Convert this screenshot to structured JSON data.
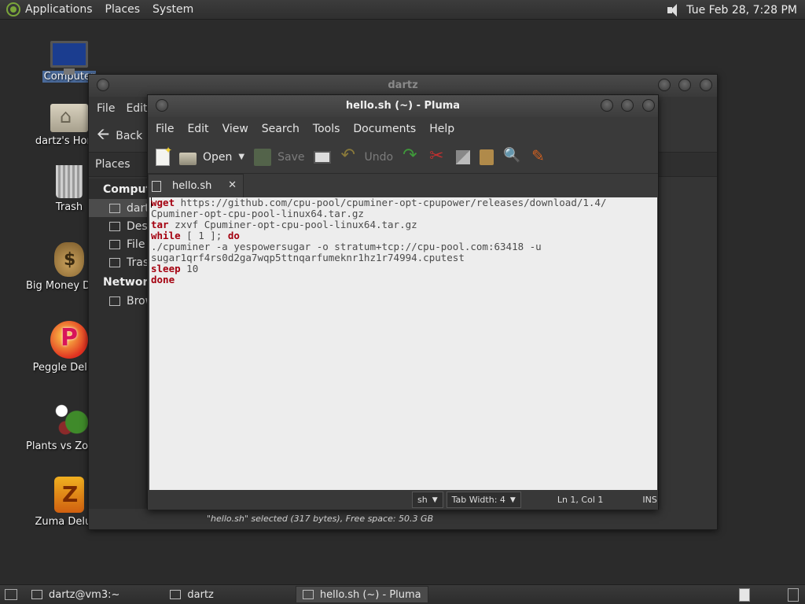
{
  "top_panel": {
    "menus": [
      "Applications",
      "Places",
      "System"
    ],
    "clock": "Tue Feb 28,  7:28 PM"
  },
  "desktop_icons": [
    {
      "label": "Computer",
      "icon": "computer-icon"
    },
    {
      "label": "dartz's Home",
      "icon": "home-folder-icon"
    },
    {
      "label": "Trash",
      "icon": "trash-icon"
    },
    {
      "label": "Big Money Deluxe",
      "icon": "money-bag-icon"
    },
    {
      "label": "Peggle Deluxe",
      "icon": "peggle-icon"
    },
    {
      "label": "Plants vs Zombies",
      "icon": "plants-icon"
    },
    {
      "label": "Zuma Deluxe",
      "icon": "zuma-icon"
    }
  ],
  "file_manager": {
    "title": "dartz",
    "menus": [
      "File",
      "Edit"
    ],
    "back_label": "Back",
    "places_label": "Places",
    "sidebar": {
      "computer_heading": "Computer",
      "computer_items": [
        "dartz",
        "Desktop",
        "File System",
        "Trash"
      ],
      "network_heading": "Network",
      "network_items": [
        "Browse Network"
      ]
    },
    "status": "\"hello.sh\" selected (317 bytes), Free space: 50.3 GB"
  },
  "pluma": {
    "title": "hello.sh (~) - Pluma",
    "menus": [
      "File",
      "Edit",
      "View",
      "Search",
      "Tools",
      "Documents",
      "Help"
    ],
    "toolbar": {
      "open": "Open",
      "save": "Save",
      "undo": "Undo"
    },
    "tab_label": "hello.sh",
    "tab_close": "✕",
    "code": {
      "l1_kw": "wget",
      "l1_rest": " https://github.com/cpu-pool/cpuminer-opt-cpupower/releases/download/1.4/",
      "l2": "Cpuminer-opt-cpu-pool-linux64.tar.gz",
      "l3_kw": "tar",
      "l3_rest": " zxvf Cpuminer-opt-cpu-pool-linux64.tar.gz",
      "l4_kw1": "while",
      "l4_mid1": " [ ",
      "l4_num": "1",
      "l4_mid2": " ]; ",
      "l4_kw2": "do",
      "l5": "./cpuminer -a yespowersugar -o stratum+tcp://cpu-pool.com:63418 -u",
      "l6": "sugar1qrf4rs0d2ga7wqp5ttnqarfumeknr1hz1r74994.cputest",
      "l7_kw": "sleep",
      "l7_rest": " 10",
      "l8_kw": "done"
    },
    "statusbar": {
      "language": "sh",
      "tab_width": "Tab Width:  4",
      "position": "Ln 1, Col 1",
      "mode": "INS"
    }
  },
  "taskbar": {
    "tasks": [
      "dartz@vm3:~",
      "dartz",
      "hello.sh (~) - Pluma"
    ]
  }
}
